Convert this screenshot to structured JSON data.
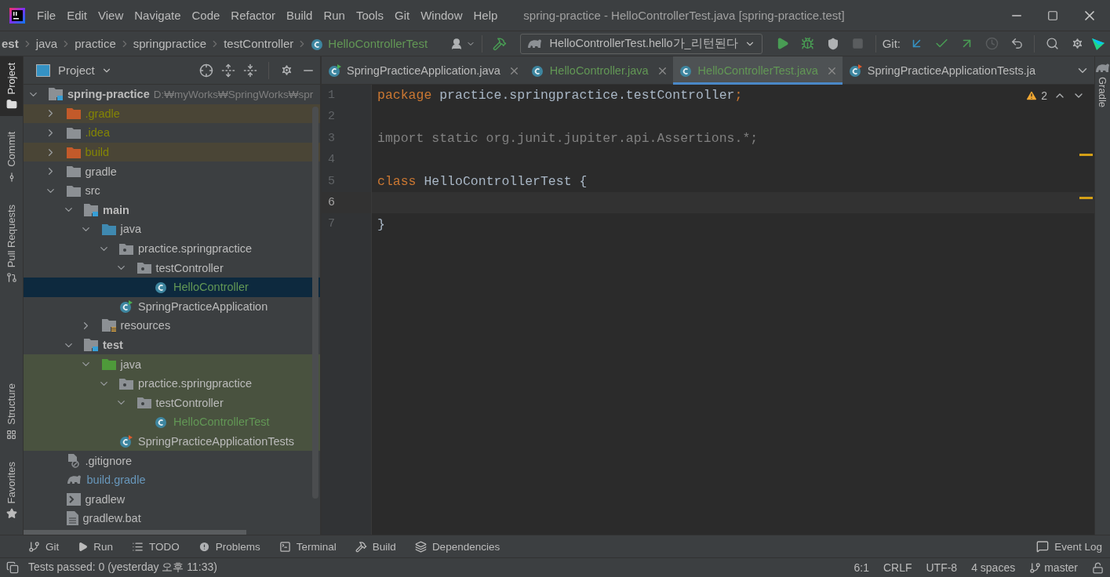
{
  "menu": [
    "File",
    "Edit",
    "View",
    "Navigate",
    "Code",
    "Refactor",
    "Build",
    "Run",
    "Tools",
    "Git",
    "Window",
    "Help"
  ],
  "window": {
    "title": "spring-practice - HelloControllerTest.java [spring-practice.test]"
  },
  "breadcrumbs": [
    {
      "label": "est",
      "kind": "folder"
    },
    {
      "label": "java",
      "kind": "folder"
    },
    {
      "label": "practice",
      "kind": "folder"
    },
    {
      "label": "springpractice",
      "kind": "folder"
    },
    {
      "label": "testController",
      "kind": "folder"
    },
    {
      "label": "HelloControllerTest",
      "kind": "class"
    }
  ],
  "toolbar": {
    "run_config": "HelloControllerTest.hello가_리턴된다",
    "git_label": "Git:",
    "stop_disabled": true,
    "history_disabled": true
  },
  "left_tabs": [
    {
      "label": "Project",
      "selected": true
    },
    {
      "label": "Commit",
      "selected": false
    },
    {
      "label": "Pull Requests",
      "selected": false
    }
  ],
  "left_tabs_bottom": [
    {
      "label": "Structure",
      "selected": false
    },
    {
      "label": "Favorites",
      "selected": false
    }
  ],
  "right_tabs": [
    {
      "label": "Gradle"
    }
  ],
  "project": {
    "title": "Project",
    "tree": [
      {
        "label": "spring-practice",
        "path": "D:₩myWorks₩SpringWorks₩spr",
        "kind": "module",
        "expanded": true,
        "selected": false,
        "children": [
          {
            "label": ".gradle",
            "kind": "excluded",
            "color": "#848504",
            "expanded": false,
            "selected": false
          },
          {
            "label": ".idea",
            "kind": "folder",
            "color": "#848504",
            "expanded": false,
            "selected": false
          },
          {
            "label": "build",
            "kind": "excluded",
            "color": "#848504",
            "expanded": false,
            "selected": false
          },
          {
            "label": "gradle",
            "kind": "folder",
            "expanded": false,
            "selected": false
          },
          {
            "label": "src",
            "kind": "folder",
            "expanded": true,
            "selected": false,
            "children": [
              {
                "label": "main",
                "kind": "module",
                "expanded": true,
                "selected": false,
                "children": [
                  {
                    "label": "java",
                    "kind": "source",
                    "expanded": true,
                    "selected": false,
                    "children": [
                      {
                        "label": "practice.springpractice",
                        "kind": "package",
                        "expanded": true,
                        "selected": false,
                        "children": [
                          {
                            "label": "testController",
                            "kind": "package",
                            "expanded": true,
                            "selected": false,
                            "children": [
                              {
                                "label": "HelloController",
                                "kind": "class",
                                "color": "#629755",
                                "selected": true
                              }
                            ]
                          }
                        ]
                      },
                      {
                        "label": "SpringPracticeApplication",
                        "kind": "app-class",
                        "selected": false
                      }
                    ]
                  },
                  {
                    "label": "resources",
                    "kind": "resources",
                    "expanded": false,
                    "selected": false
                  }
                ]
              },
              {
                "label": "test",
                "kind": "module",
                "expanded": true,
                "selected": false,
                "children": [
                  {
                    "label": "java",
                    "kind": "test-source",
                    "test_scope": true,
                    "expanded": true,
                    "selected": false,
                    "children": [
                      {
                        "label": "practice.springpractice",
                        "kind": "package",
                        "test_scope": true,
                        "expanded": true,
                        "selected": false,
                        "children": [
                          {
                            "label": "testController",
                            "kind": "package",
                            "test_scope": true,
                            "expanded": true,
                            "selected": false,
                            "children": [
                              {
                                "label": "HelloControllerTest",
                                "kind": "class",
                                "color": "#629755",
                                "test_scope": true,
                                "selected": false
                              }
                            ]
                          }
                        ]
                      },
                      {
                        "label": "SpringPracticeApplicationTests",
                        "kind": "test-app-class",
                        "test_scope": true,
                        "selected": false
                      }
                    ]
                  }
                ]
              }
            ]
          },
          {
            "label": ".gitignore",
            "kind": "gitignore",
            "selected": false
          },
          {
            "label": "build.gradle",
            "kind": "gradle",
            "color": "#6897bb",
            "selected": false
          },
          {
            "label": "gradlew",
            "kind": "script",
            "selected": false
          },
          {
            "label": "gradlew.bat",
            "kind": "file",
            "selected": false
          }
        ]
      }
    ]
  },
  "tabs": [
    {
      "label": "SpringPracticeApplication.java",
      "kind": "app-class",
      "selected": false,
      "closable": true
    },
    {
      "label": "HelloController.java",
      "kind": "class",
      "color": "#629755",
      "selected": false,
      "closable": true
    },
    {
      "label": "HelloControllerTest.java",
      "kind": "class",
      "color": "#629755",
      "selected": true,
      "closable": true
    },
    {
      "label": "SpringPracticeApplicationTests.ja",
      "kind": "test-app-class",
      "selected": false,
      "closable": false
    }
  ],
  "editor": {
    "warnings": "2",
    "lines": [
      {
        "number": "1",
        "current": false,
        "tokens": [
          {
            "text": "package",
            "kind": "keyword"
          },
          {
            "text": " practice.springpractice.testController",
            "kind": "ident"
          },
          {
            "text": ";",
            "kind": "keyword"
          }
        ]
      },
      {
        "number": "2",
        "current": false
      },
      {
        "number": "3",
        "current": false,
        "tokens": [
          {
            "text": "import static org.junit.jupiter.api.Assertions.*;",
            "kind": "unused"
          }
        ]
      },
      {
        "number": "4",
        "current": false
      },
      {
        "number": "5",
        "current": false,
        "tokens": [
          {
            "text": "class",
            "kind": "keyword"
          },
          {
            "text": " HelloControllerTest {",
            "kind": "ident"
          }
        ]
      },
      {
        "number": "6",
        "current": true
      },
      {
        "number": "7",
        "current": false,
        "tokens": [
          {
            "text": "}",
            "kind": "ident"
          }
        ]
      }
    ]
  },
  "tool_windows": [
    "Git",
    "Run",
    "TODO",
    "Problems",
    "Terminal",
    "Build",
    "Dependencies"
  ],
  "event_log": "Event Log",
  "status_bar": {
    "message": "Tests passed: 0 (yesterday 오후 11:33)",
    "position": "6:1",
    "line_ending": "CRLF",
    "encoding": "UTF-8",
    "indent": "4 spaces",
    "branch": "master"
  }
}
